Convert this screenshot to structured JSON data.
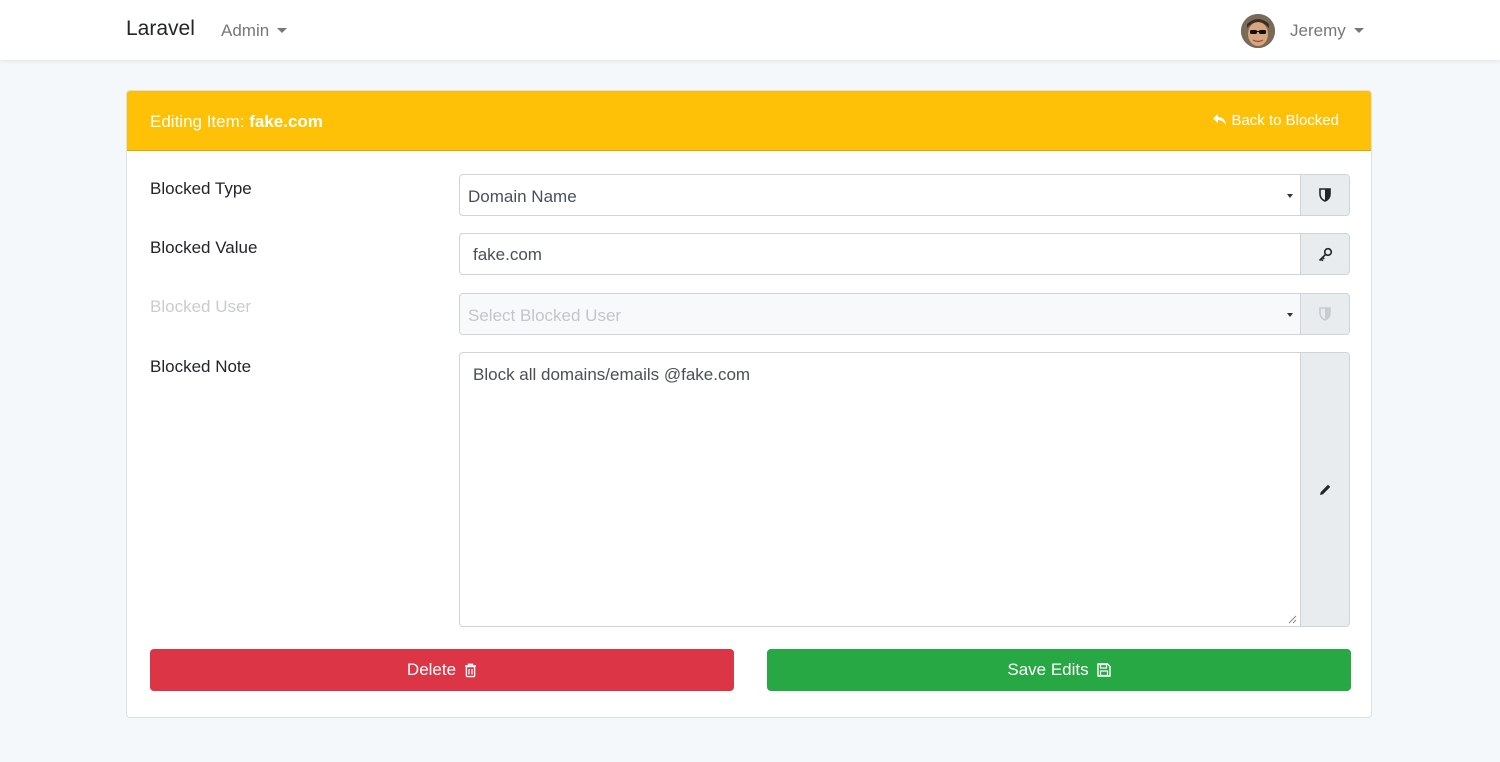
{
  "nav": {
    "brand": "Laravel",
    "admin_menu": "Admin",
    "user_name": "Jeremy"
  },
  "card": {
    "title_prefix": "Editing Item: ",
    "title_value": "fake.com",
    "back_link": "Back to Blocked"
  },
  "form": {
    "blocked_type": {
      "label": "Blocked Type",
      "value": "Domain Name",
      "icon": "shield-icon"
    },
    "blocked_value": {
      "label": "Blocked Value",
      "value": "fake.com",
      "icon": "key-icon"
    },
    "blocked_user": {
      "label": "Blocked User",
      "placeholder": "Select Blocked User",
      "icon": "shield-icon"
    },
    "blocked_note": {
      "label": "Blocked Note",
      "value": "Block all domains/emails @fake.com",
      "icon": "pencil-icon"
    }
  },
  "actions": {
    "delete_label": "Delete",
    "save_label": "Save Edits"
  },
  "colors": {
    "header": "#ffc107",
    "delete": "#dc3545",
    "save": "#28a745"
  }
}
